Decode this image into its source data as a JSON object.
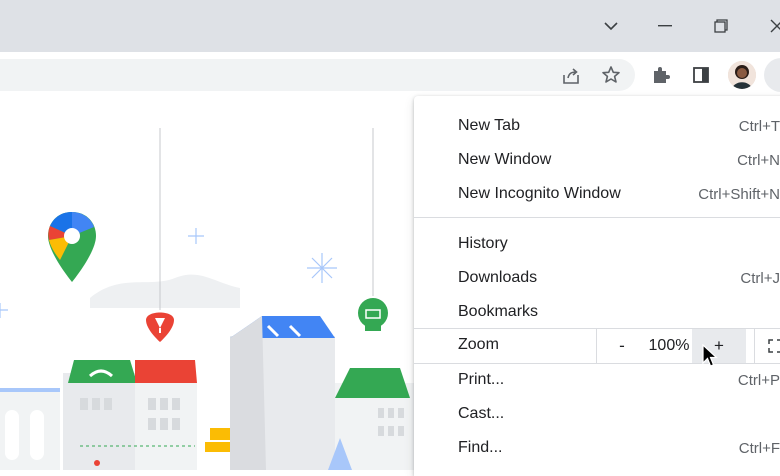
{
  "window": {
    "controls": {
      "tabs_menu": "chevron-down-icon",
      "minimize": "minimize-icon",
      "restore": "restore-icon",
      "close": "close-icon"
    }
  },
  "toolbar": {
    "icons": [
      "share-icon",
      "star-icon",
      "extensions-icon",
      "side-panel-icon",
      "profile-avatar",
      "menu-icon"
    ]
  },
  "menu": {
    "new_tab": {
      "label": "New Tab",
      "shortcut": "Ctrl+T"
    },
    "new_window": {
      "label": "New Window",
      "shortcut": "Ctrl+N"
    },
    "new_incognito": {
      "label": "New Incognito Window",
      "shortcut": "Ctrl+Shift+N"
    },
    "history": {
      "label": "History"
    },
    "downloads": {
      "label": "Downloads",
      "shortcut": "Ctrl+J"
    },
    "bookmarks": {
      "label": "Bookmarks"
    },
    "zoom": {
      "label": "Zoom",
      "minus": "-",
      "value": "100%",
      "plus": "+"
    },
    "print": {
      "label": "Print...",
      "shortcut": "Ctrl+P"
    },
    "cast": {
      "label": "Cast..."
    },
    "find": {
      "label": "Find...",
      "shortcut": "Ctrl+F"
    }
  },
  "colors": {
    "accent_blue": "#4285f4",
    "maps_red": "#ea4335",
    "maps_yellow": "#fbbc04",
    "maps_green": "#34a853",
    "titlebar": "#dee1e6"
  }
}
